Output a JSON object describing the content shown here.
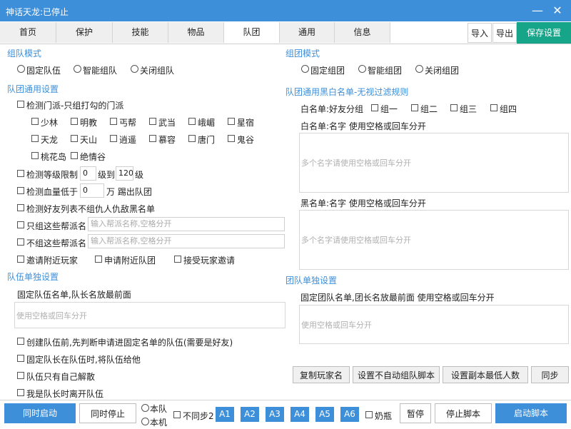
{
  "window": {
    "title": "神话天龙:已停止",
    "minimize": "—",
    "close": "✕"
  },
  "tabs": [
    "首页",
    "保护",
    "技能",
    "物品",
    "队团",
    "通用",
    "信息"
  ],
  "toolbar": {
    "import": "导入",
    "export": "导出",
    "save": "保存设置"
  },
  "left": {
    "team_mode_title": "组队模式",
    "team_mode_options": [
      "固定队伍",
      "智能组队",
      "关闭组队"
    ],
    "general_title": "队团通用设置",
    "check_sect": "检测门派-只组打勾的门派",
    "sects": [
      "少林",
      "明教",
      "丐帮",
      "武当",
      "峨嵋",
      "星宿",
      "天龙",
      "天山",
      "逍遥",
      "慕容",
      "唐门",
      "鬼谷",
      "桃花岛",
      "绝情谷"
    ],
    "level_limit": {
      "label": "检测等级限制",
      "min": "0",
      "mid": "级到",
      "max": "120",
      "end": "级"
    },
    "hp_limit": {
      "label": "检测血量低于",
      "value": "0",
      "end": "万 踢出队团"
    },
    "friend_check": "检测好友列表不组仇人仇敌黑名单",
    "only_groups": {
      "label": "只组这些帮派名",
      "placeholder": "输入帮派名称,空格分开"
    },
    "no_groups": {
      "label": "不组这些帮派名",
      "placeholder": "输入帮派名称,空格分开"
    },
    "invite_opts": [
      "邀请附近玩家",
      "申请附近队团",
      "接受玩家邀请"
    ],
    "team_single_title": "队伍单独设置",
    "fixed_team_list": "固定队伍名单,队长名放最前面",
    "fixed_team_placeholder": "使用空格或回车分开",
    "team_checks": [
      "创建队伍前,先判断申请进固定名单的队伍(需要是好友)",
      "固定队长在队伍时,将队伍给他",
      "队伍只有自己解散",
      "我是队长时离开队伍"
    ]
  },
  "right": {
    "group_mode_title": "组团模式",
    "group_mode_options": [
      "固定组团",
      "智能组团",
      "关闭组团"
    ],
    "bw_title": "队团通用黑白名单-无视过滤规则",
    "white_group_label": "白名单:好友分组",
    "white_groups": [
      "组一",
      "组二",
      "组三",
      "组四"
    ],
    "white_names_label": "白名单:名字 使用空格或回车分开",
    "white_placeholder": "多个名字请使用空格或回车分开",
    "black_names_label": "黑名单:名字 使用空格或回车分开",
    "black_placeholder": "多个名字请使用空格或回车分开",
    "group_single_title": "团队单独设置",
    "fixed_group_list": "固定团队名单,团长名放最前面 使用空格或回车分开",
    "fixed_group_placeholder": "使用空格或回车分开",
    "buttons": [
      "复制玩家名",
      "设置不自动组队脚本",
      "设置副本最低人数",
      "同步"
    ]
  },
  "bottom": {
    "start_all": "同时启动",
    "stop_all": "同时停止",
    "radio_options": [
      "本队",
      "本机"
    ],
    "no_sync": "不同步2",
    "accounts": [
      "A1",
      "A2",
      "A3",
      "A4",
      "A5",
      "A6"
    ],
    "bottle": "奶瓶",
    "pause": "暂停",
    "stop_script": "停止脚本",
    "start_script": "启动脚本"
  }
}
